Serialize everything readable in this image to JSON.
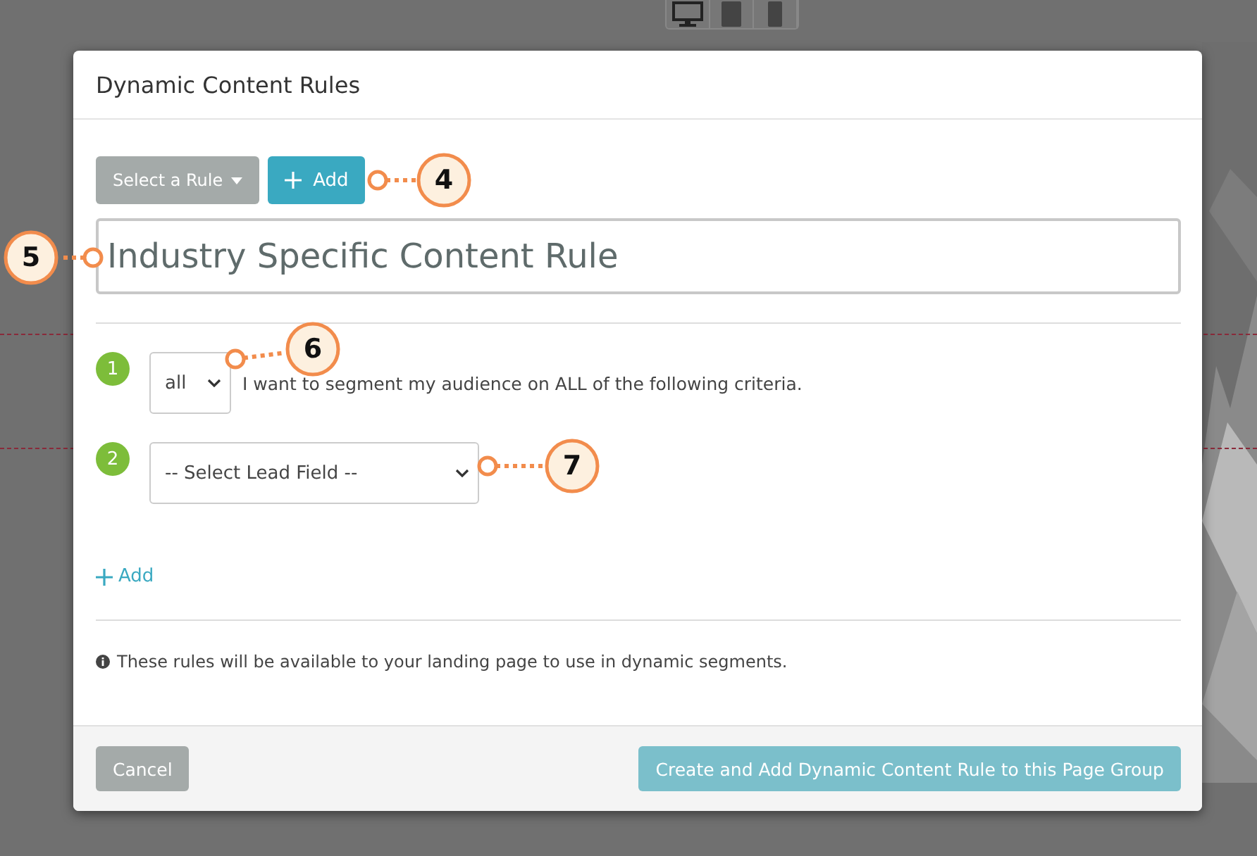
{
  "dialog": {
    "title": "Dynamic Content Rules",
    "rule_select": {
      "label": "Select a Rule"
    },
    "add_button": {
      "label": "Add"
    },
    "rule_name": {
      "value": "Industry Specific Content Rule"
    },
    "criteria": [
      {
        "number": "1",
        "kind": "match",
        "value": "all",
        "text": "I want to segment my audience on ALL of the following criteria."
      },
      {
        "number": "2",
        "kind": "field",
        "value": "-- Select Lead Field --"
      }
    ],
    "add_link": "Add",
    "info": "These rules will be available to your landing page to use in dynamic segments.",
    "buttons": [
      {
        "label": "Cancel",
        "kind": "secondary"
      },
      {
        "label": "Create and Add Dynamic Content Rule to this Page Group",
        "kind": "primary"
      }
    ]
  },
  "callouts": [
    {
      "number": "4"
    },
    {
      "number": "5"
    },
    {
      "number": "6"
    },
    {
      "number": "7"
    }
  ]
}
